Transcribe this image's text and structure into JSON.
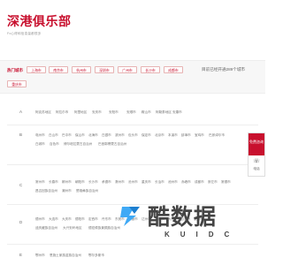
{
  "header": {
    "logo": "深港俱乐部",
    "tagline": "Fx心得和信息量都很多"
  },
  "hot": {
    "label": "热门城市",
    "cities": [
      "上海市",
      "南京市",
      "杭州市",
      "深圳市",
      "广州市",
      "长沙市",
      "成都市",
      "重庆市"
    ],
    "open_count": "目前已经开通289个城市"
  },
  "groups": [
    {
      "letter": "A",
      "rows": [
        [
          "阿克苏地区",
          "阿拉尔市",
          "阿里地区",
          "安庆市",
          "安阳市",
          "安顺市",
          "鞍山市",
          "阿勒泰地区",
          "安康市"
        ]
      ]
    },
    {
      "letter": "B",
      "rows": [
        [
          "亳州市",
          "白山市",
          "巴中市",
          "保山市",
          "北海市",
          "白银市",
          "滨州市",
          "包头市",
          "保定市",
          "北京市",
          "本溪市",
          "蚌埠市",
          "宝鸡市",
          "巴彦淖尔市"
        ],
        [
          "白城市",
          "百色市",
          "博尔塔拉蒙古自治州",
          "巴音郭楞蒙古自治州"
        ]
      ]
    },
    {
      "letter": "C",
      "rows": [
        [
          "常州市",
          "长春市",
          "郴州市",
          "朝阳市",
          "长沙市",
          "承德市",
          "滁州市",
          "沧州市",
          "重庆市",
          "长治市",
          "池州市",
          "赤峰市",
          "成都市",
          "崇左市",
          "常德市"
        ],
        [
          "昌吉回族自治州",
          "潮州市",
          "楚雄彝族自治州"
        ]
      ]
    },
    {
      "letter": "D",
      "rows": [
        [
          "德州市",
          "大连市",
          "大庆市",
          "德阳市",
          "定西市",
          "丹东市",
          "东莞市",
          "东营市",
          "达州市",
          "大同市",
          "大理白族自治州",
          "儋州市"
        ],
        [
          "迪庆藏族自治州",
          "大兴安岭地区",
          "德宏傣族景颇族自治州"
        ]
      ]
    },
    {
      "letter": "E",
      "rows": [
        [
          "鄂州市",
          "恩施土家族苗族自治州",
          "鄂尔多斯市"
        ]
      ]
    }
  ],
  "float": {
    "free_label": "免费咨询",
    "phone_label": "电话"
  },
  "watermark": {
    "text": "酷数据",
    "sub": "KUIDC"
  },
  "colors": {
    "brand": "#c8102e",
    "background": "#ffffff",
    "bar": "#f7f7f7"
  }
}
